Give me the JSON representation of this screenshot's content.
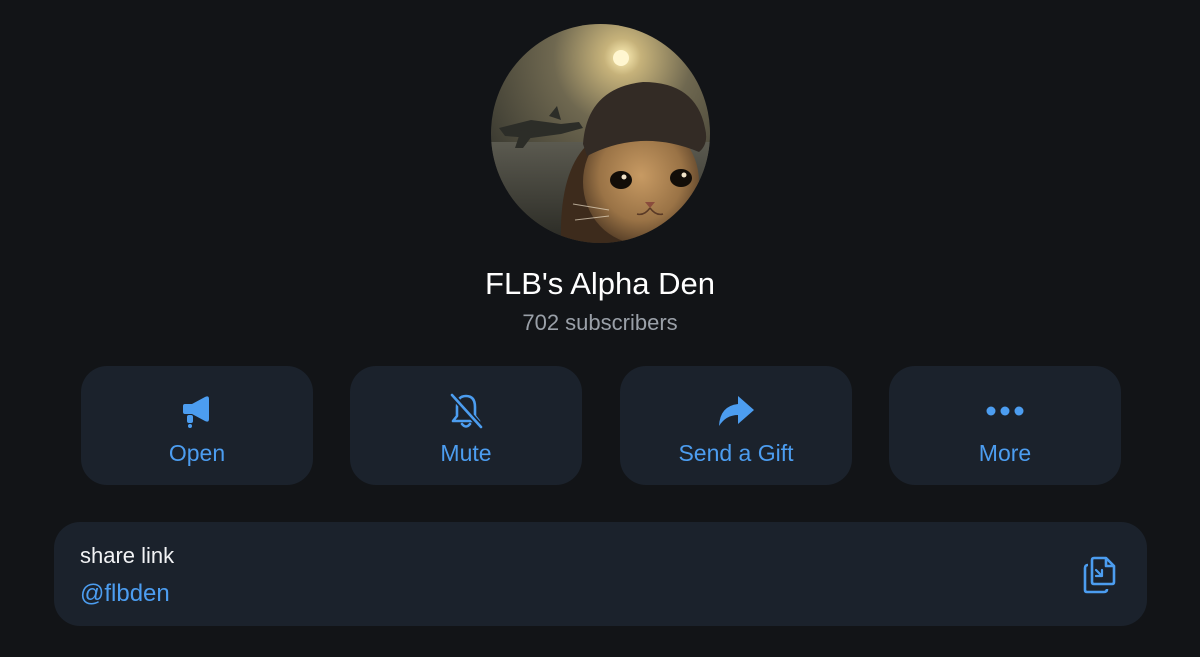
{
  "channel": {
    "name": "FLB's Alpha Den",
    "subscribers": "702 subscribers"
  },
  "actions": [
    {
      "label": "Open",
      "icon": "megaphone-icon"
    },
    {
      "label": "Mute",
      "icon": "bell-slash-icon"
    },
    {
      "label": "Send a Gift",
      "icon": "share-arrow-icon"
    },
    {
      "label": "More",
      "icon": "more-dots-icon"
    }
  ],
  "share": {
    "caption": "share link",
    "value": "@flbden",
    "icon": "copy-icon"
  },
  "colors": {
    "background": "#121417",
    "card": "#1b222c",
    "accent": "#4c9df0",
    "primary_text": "#ffffff",
    "secondary_text": "#9aa0a8"
  }
}
